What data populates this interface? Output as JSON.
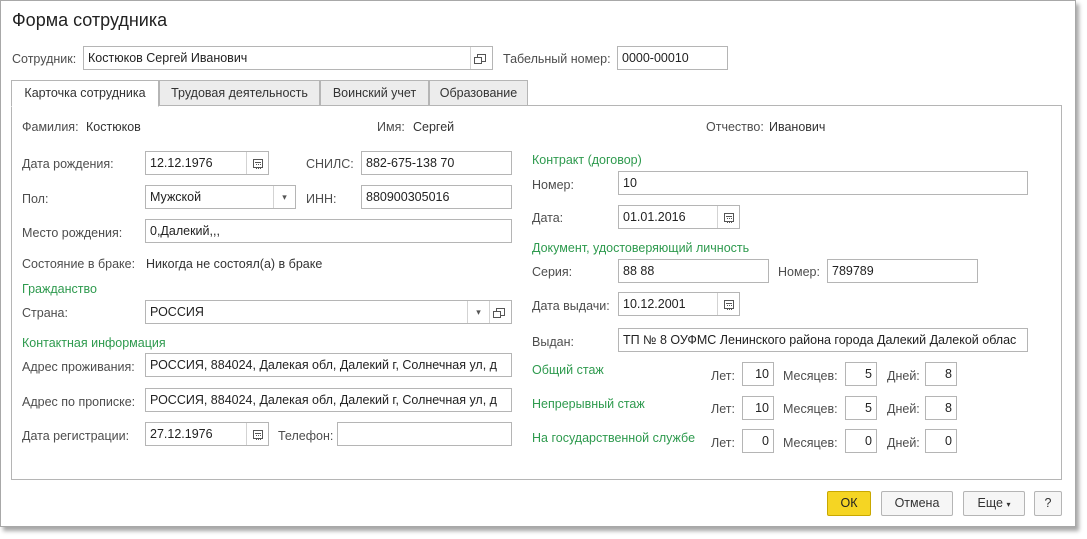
{
  "window": {
    "title": "Форма сотрудника"
  },
  "header": {
    "employee_label": "Сотрудник:",
    "employee_value": "Костюков Сергей Иванович",
    "tab_number_label": "Табельный номер:",
    "tab_number_value": "0000-00010"
  },
  "tabs": [
    {
      "label": "Карточка сотрудника",
      "active": true
    },
    {
      "label": "Трудовая деятельность",
      "active": false
    },
    {
      "label": "Воинский учет",
      "active": false
    },
    {
      "label": "Образование",
      "active": false
    }
  ],
  "name": {
    "surname_label": "Фамилия:",
    "surname": "Костюков",
    "first_label": "Имя:",
    "first": "Сергей",
    "patronymic_label": "Отчество:",
    "patronymic": "Иванович"
  },
  "personal": {
    "birth_date_label": "Дата рождения:",
    "birth_date": "12.12.1976",
    "snils_label": "СНИЛС:",
    "snils": "882-675-138 70",
    "gender_label": "Пол:",
    "gender": "Мужской",
    "inn_label": "ИНН:",
    "inn": "880900305016",
    "birth_place_label": "Место рождения:",
    "birth_place": "0,Далекий,,,",
    "marital_label": "Состояние в браке:",
    "marital": "Никогда не состоял(а) в браке"
  },
  "citizenship": {
    "group": "Гражданство",
    "country_label": "Страна:",
    "country": "РОССИЯ"
  },
  "contacts": {
    "group": "Контактная информация",
    "residence_label": "Адрес проживания:",
    "residence": "РОССИЯ, 884024, Далекая обл, Далекий г, Солнечная ул, д",
    "registration_label": "Адрес по прописке:",
    "registration": "РОССИЯ, 884024, Далекая обл, Далекий г, Солнечная ул, д",
    "reg_date_label": "Дата регистрации:",
    "reg_date": "27.12.1976",
    "phone_label": "Телефон:",
    "phone": ""
  },
  "contract": {
    "group": "Контракт (договор)",
    "number_label": "Номер:",
    "number": "10",
    "date_label": "Дата:",
    "date": "01.01.2016"
  },
  "identity": {
    "group": "Документ, удостоверяющий личность",
    "series_label": "Серия:",
    "series": "88 88",
    "number_label": "Номер:",
    "number": "789789",
    "issue_date_label": "Дата выдачи:",
    "issue_date": "10.12.2001",
    "issued_by_label": "Выдан:",
    "issued_by": "ТП № 8 ОУФМС Ленинского района города Далекий Далекой облас"
  },
  "experience": {
    "years_label": "Лет:",
    "months_label": "Месяцев:",
    "days_label": "Дней:",
    "rows": [
      {
        "label": "Общий стаж",
        "years": "10",
        "months": "5",
        "days": "8"
      },
      {
        "label": "Непрерывный стаж",
        "years": "10",
        "months": "5",
        "days": "8"
      },
      {
        "label": "На государственной службе",
        "years": "0",
        "months": "0",
        "days": "0"
      }
    ]
  },
  "footer": {
    "ok": "ОК",
    "cancel": "Отмена",
    "more": "Еще",
    "help": "?"
  },
  "colors": {
    "accent": "#f5d523",
    "group_header": "#2e9a4e"
  },
  "icons": [
    "open-icon",
    "calendar-icon",
    "dropdown-arrow-icon"
  ]
}
